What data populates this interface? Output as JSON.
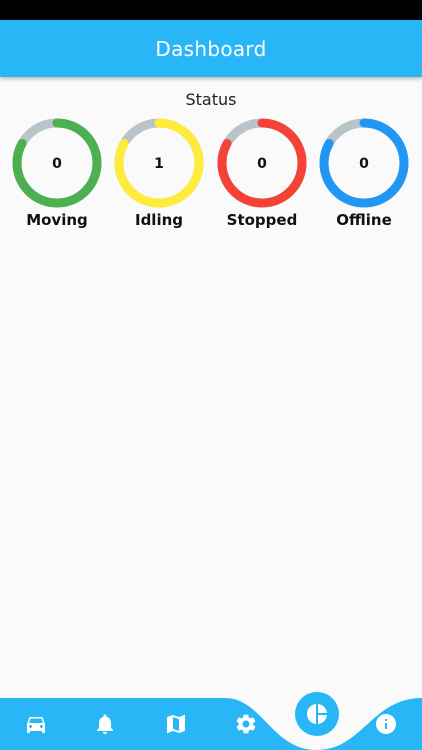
{
  "app_bar": {
    "title": "Dashboard"
  },
  "status": {
    "title": "Status",
    "items": [
      {
        "label": "Moving",
        "count": "0",
        "color": "#4caf50",
        "fraction": 0.83
      },
      {
        "label": "Idling",
        "count": "1",
        "color": "#ffeb3b",
        "fraction": 0.83
      },
      {
        "label": "Stopped",
        "count": "0",
        "color": "#f44336",
        "fraction": 0.83
      },
      {
        "label": "Offline",
        "count": "0",
        "color": "#2196f3",
        "fraction": 0.83
      }
    ],
    "track_color": "#b8c4c8"
  },
  "bottom_nav": {
    "color": "#29b6f6",
    "items": [
      {
        "name": "car-icon"
      },
      {
        "name": "bell-icon"
      },
      {
        "name": "map-icon"
      },
      {
        "name": "gear-icon"
      },
      {
        "name": "pie-chart-icon",
        "active": true
      },
      {
        "name": "info-icon"
      }
    ]
  }
}
